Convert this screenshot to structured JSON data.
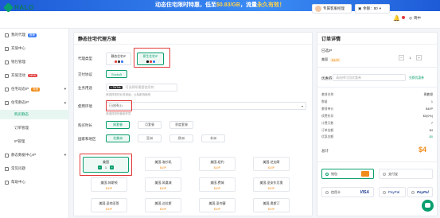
{
  "banner": {
    "prefix": "动态住宅限时特惠，低至",
    "price": "$0.83/GB",
    "suffix": "，流量",
    "tail": "永久有效！"
  },
  "header": {
    "logo": "HALO",
    "manager_label": "专属客服经理",
    "balance_label": "余额：$0",
    "lang": "简中"
  },
  "sidebar": {
    "items": [
      {
        "label": "我的代理",
        "badge": "推荐"
      },
      {
        "label": "充值中心"
      },
      {
        "label": "钱包管理"
      },
      {
        "label": "充值活动",
        "badge": "NEW"
      },
      {
        "label": "住宅动态IP",
        "badge": "特惠"
      },
      {
        "label": "住宅静态IP"
      },
      {
        "label": "购买静态"
      },
      {
        "label": "订单管理"
      },
      {
        "label": "IP管理"
      },
      {
        "label": "静态数据中心IP"
      },
      {
        "label": "常见问题"
      },
      {
        "label": "帮助中心"
      }
    ]
  },
  "main": {
    "title": "静态住宅代理方案",
    "type_label": "代理类型",
    "type_options": [
      "静态住宅IP",
      "原生住宅IP"
    ],
    "pay_label": "交付协议",
    "pay_value": "Socks5",
    "business_label": "业务用途",
    "business_value": "TikTok",
    "business_placeholder": "可选择所需要使用的",
    "business_hint": "请选择您的业务用途，以免影响使用",
    "env_label": "使用环境",
    "env_value": "已选择(1)",
    "env_hint": "请选择您的使用环境",
    "duration_label": "购买时长",
    "durations": [
      "周套餐",
      "月套餐",
      "季度套餐"
    ],
    "region_label": "国家和地区",
    "regions": [
      "北美洲",
      "亚洲",
      "欧洲",
      "非洲"
    ],
    "cities": [
      {
        "name": "美国",
        "price": "",
        "qty": "1"
      },
      {
        "name": "美国-洛杉矶",
        "price": "$4/IP"
      },
      {
        "name": "美国-纽约",
        "price": "$4/IP"
      },
      {
        "name": "美国-芝加哥",
        "price": "$4/IP"
      },
      {
        "name": "美国-休斯顿",
        "price": "$4/IP"
      },
      {
        "name": "美国-凤凰城",
        "price": "$4/IP"
      },
      {
        "name": "美国-费城",
        "price": "$4/IP"
      },
      {
        "name": "美国-圣安东尼奥",
        "price": "$4/IP"
      },
      {
        "name": "美国-圣地亚哥",
        "price": "$4/IP"
      },
      {
        "name": "美国-达拉斯",
        "price": "$4/IP"
      },
      {
        "name": "美国-圣何塞",
        "price": "$4/IP"
      },
      {
        "name": "美国-奥斯汀",
        "price": "$4/IP"
      },
      {
        "name": "美国-拉斯维加斯",
        "price": "$4/IP"
      },
      {
        "name": "美国-迈阿密",
        "price": "$4/IP"
      },
      {
        "name": "美国-华盛顿",
        "price": "$4/IP"
      },
      {
        "name": "美国-波士顿",
        "price": "$4/IP"
      }
    ]
  },
  "order": {
    "title": "订单详情",
    "selected_label": "已选IP",
    "selected_item": "美国",
    "selected_price": "$4/IP",
    "qty": "1",
    "coupon_label": "优惠券",
    "coupon_placeholder": "请选择可用优惠券",
    "coupon_link": "兑换优惠券",
    "details": [
      {
        "k": "套餐名称",
        "v": "周套餐"
      },
      {
        "k": "数量",
        "v": "1"
      },
      {
        "k": "套餐单价",
        "v": "$4/IP"
      },
      {
        "k": "续费折扣",
        "v": "$0(0%)"
      },
      {
        "k": "计费天数",
        "v": "7"
      },
      {
        "k": "订单金额",
        "v": "$4"
      },
      {
        "k": "优惠金额",
        "v": "-$0"
      }
    ],
    "total_label": "总计",
    "total": "$4",
    "payments": [
      "钱包",
      "支付宝",
      "信用卡",
      "VISA",
      "PayPal",
      "PayPal"
    ]
  },
  "colors": {
    "brand": "#0a9e6e",
    "price": "#f08c1a",
    "highlight": "#e23b3b"
  }
}
